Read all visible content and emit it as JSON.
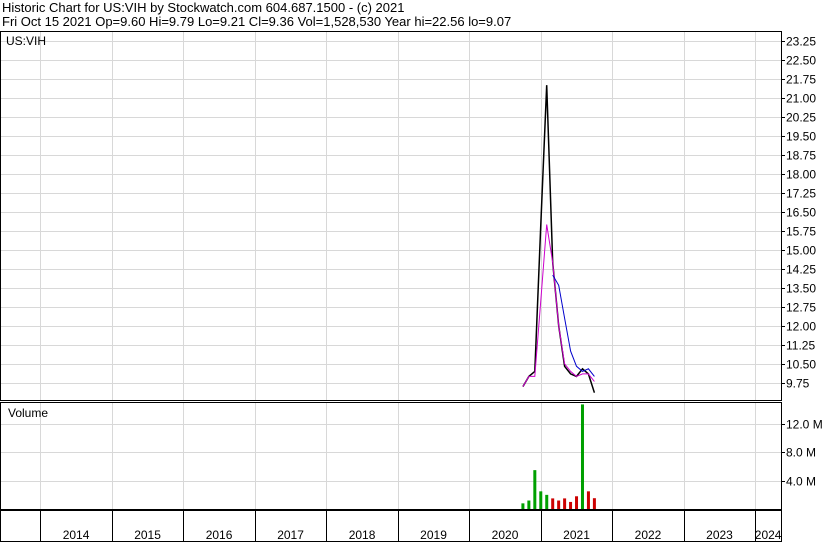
{
  "header": {
    "line1": "Historic Chart for US:VIH by Stockwatch.com 604.687.1500 - (c) 2021",
    "line2": "Fri Oct 15 2021  Op=9.60  Hi=9.79  Lo=9.21  Cl=9.36  Vol=1,528,530  Year hi=22.56  lo=9.07"
  },
  "chart_data": [
    {
      "type": "line",
      "title": "US:VIH",
      "ylim": [
        9.07,
        23.6
      ],
      "yticks": [
        "23.25",
        "22.50",
        "21.75",
        "21.00",
        "20.25",
        "19.50",
        "18.75",
        "18.00",
        "17.25",
        "16.50",
        "15.75",
        "15.00",
        "14.25",
        "13.50",
        "12.75",
        "12.00",
        "11.25",
        "10.50",
        "9.75"
      ],
      "x": [
        "2020-10",
        "2020-11",
        "2020-12",
        "2021-01",
        "2021-02",
        "2021-03",
        "2021-04",
        "2021-05",
        "2021-06",
        "2021-07",
        "2021-08",
        "2021-09",
        "2021-10"
      ],
      "series": [
        {
          "role": "price",
          "color": "#000000",
          "values": [
            9.6,
            10.0,
            10.2,
            16.0,
            21.5,
            14.5,
            12.0,
            10.4,
            10.1,
            10.0,
            10.3,
            10.1,
            9.36
          ]
        },
        {
          "role": "moving-average-short",
          "color": "#cc00cc",
          "values": [
            9.6,
            10.0,
            10.0,
            13.0,
            16.0,
            14.5,
            12.0,
            10.5,
            10.2,
            10.0,
            10.1,
            10.1,
            9.8
          ]
        },
        {
          "role": "moving-average-long",
          "color": "#0000cc",
          "values": [
            null,
            null,
            null,
            null,
            null,
            14.0,
            13.6,
            12.3,
            11.0,
            10.4,
            10.2,
            10.3,
            10.0
          ]
        }
      ]
    },
    {
      "type": "bar",
      "title": "Volume",
      "ylim": [
        0,
        15000000
      ],
      "yticks": [
        "12.0 M",
        "8.0 M",
        "4.0 M"
      ],
      "x": [
        "2020-10",
        "2020-11",
        "2020-12",
        "2021-01",
        "2021-02",
        "2021-03",
        "2021-04",
        "2021-05",
        "2021-06",
        "2021-07",
        "2021-08",
        "2021-09",
        "2021-10"
      ],
      "values": [
        800000,
        1200000,
        5500000,
        2500000,
        2000000,
        1500000,
        1200000,
        1500000,
        1000000,
        1800000,
        14800000,
        2500000,
        1528530
      ],
      "colors": {
        "up": "#00a000",
        "down": "#cc0000"
      }
    }
  ],
  "xaxis_labels": [
    "2014",
    "2015",
    "2016",
    "2017",
    "2018",
    "2019",
    "2020",
    "2021",
    "2022",
    "2023",
    "2024"
  ]
}
